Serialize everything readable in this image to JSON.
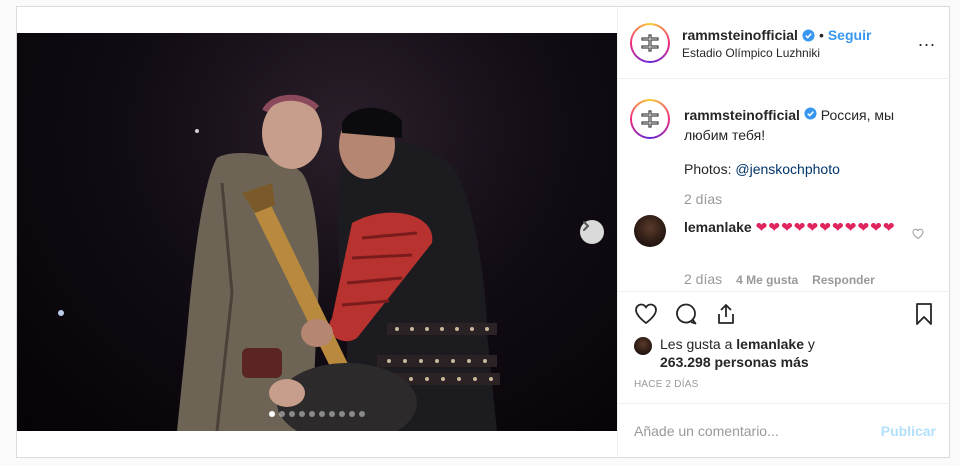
{
  "post": {
    "username": "rammsteinofficial",
    "separator": "•",
    "follow_label": "Seguir",
    "location": "Estadio Olímpico Luzhniki",
    "more_label": "...",
    "caption": {
      "username": "rammsteinofficial",
      "text": "Россия, мы любим тебя!",
      "photos_prefix": "Photos: ",
      "mention": "@jenskochphoto",
      "time": "2 días"
    },
    "comment": {
      "username": "lemanlake",
      "hearts": "❤❤❤❤❤❤❤❤❤❤❤",
      "time": "2 días",
      "likes": "4 Me gusta",
      "reply": "Responder"
    },
    "liked_by": {
      "prefix": "Les gusta a ",
      "user": "lemanlake",
      "suffix": " y",
      "count": "263.298 personas más"
    },
    "timestamp": "HACE 2 DÍAS",
    "composer": {
      "placeholder": "Añade un comentario...",
      "publish_label": "Publicar"
    },
    "carousel": {
      "slide_count": 10,
      "active_index": 0
    }
  },
  "colors": {
    "accent": "#3897f0",
    "heart": "#e0245e",
    "muted": "#999999",
    "border": "#dbdbdb"
  },
  "icons": [
    "verified-badge-icon",
    "more-options-icon",
    "chevron-right-icon",
    "heart-icon",
    "comment-icon",
    "share-icon",
    "bookmark-icon",
    "rammstein-logo-icon"
  ]
}
